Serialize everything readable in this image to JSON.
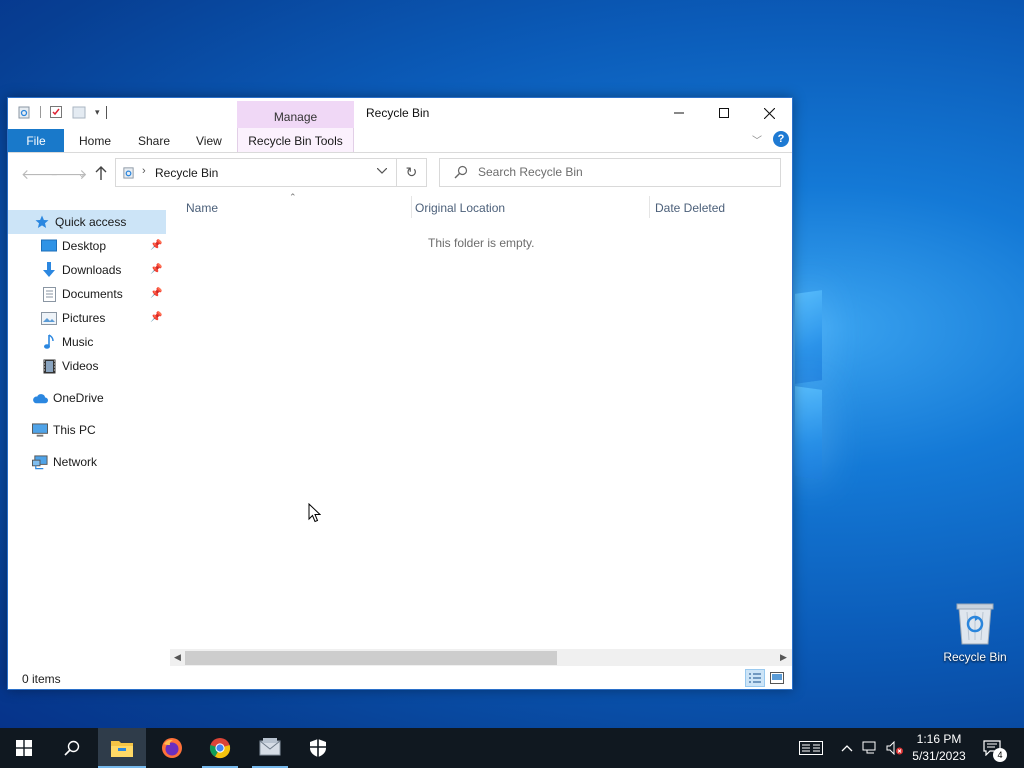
{
  "window": {
    "title": "Recycle Bin",
    "contextual_group": "Manage",
    "ribbon_tabs": [
      "File",
      "Home",
      "Share",
      "View",
      "Recycle Bin Tools"
    ],
    "help": "?"
  },
  "address": {
    "breadcrumb": "Recycle Bin",
    "search_placeholder": "Search Recycle Bin"
  },
  "nav_pane": {
    "items": [
      {
        "label": "Quick access",
        "icon": "star-icon",
        "selected": true
      },
      {
        "label": "Desktop",
        "icon": "desktop-folder-icon",
        "pinned": true
      },
      {
        "label": "Downloads",
        "icon": "download-arrow-icon",
        "pinned": true
      },
      {
        "label": "Documents",
        "icon": "documents-icon",
        "pinned": true
      },
      {
        "label": "Pictures",
        "icon": "pictures-icon",
        "pinned": true
      },
      {
        "label": "Music",
        "icon": "music-note-icon"
      },
      {
        "label": "Videos",
        "icon": "film-icon"
      },
      {
        "label": "OneDrive",
        "icon": "cloud-icon"
      },
      {
        "label": "This PC",
        "icon": "monitor-icon"
      },
      {
        "label": "Network",
        "icon": "network-icon"
      }
    ]
  },
  "content": {
    "columns": [
      "Name",
      "Original Location",
      "Date Deleted"
    ],
    "empty_message": "This folder is empty."
  },
  "status": {
    "item_count": "0 items"
  },
  "desktop": {
    "recycle_bin_label": "Recycle Bin"
  },
  "taskbar": {
    "apps": [
      "start-icon",
      "search-icon",
      "file-explorer-icon",
      "firefox-icon",
      "chrome-icon",
      "mail-app-icon",
      "security-shield-icon"
    ],
    "clock_time": "1:16 PM",
    "clock_date": "5/31/2023",
    "notification_count": "4"
  },
  "colors": {
    "accent": "#1979ca",
    "contextual_tab": "#f0d8f6",
    "selection": "#cce4f7",
    "taskbar": "#101820"
  }
}
